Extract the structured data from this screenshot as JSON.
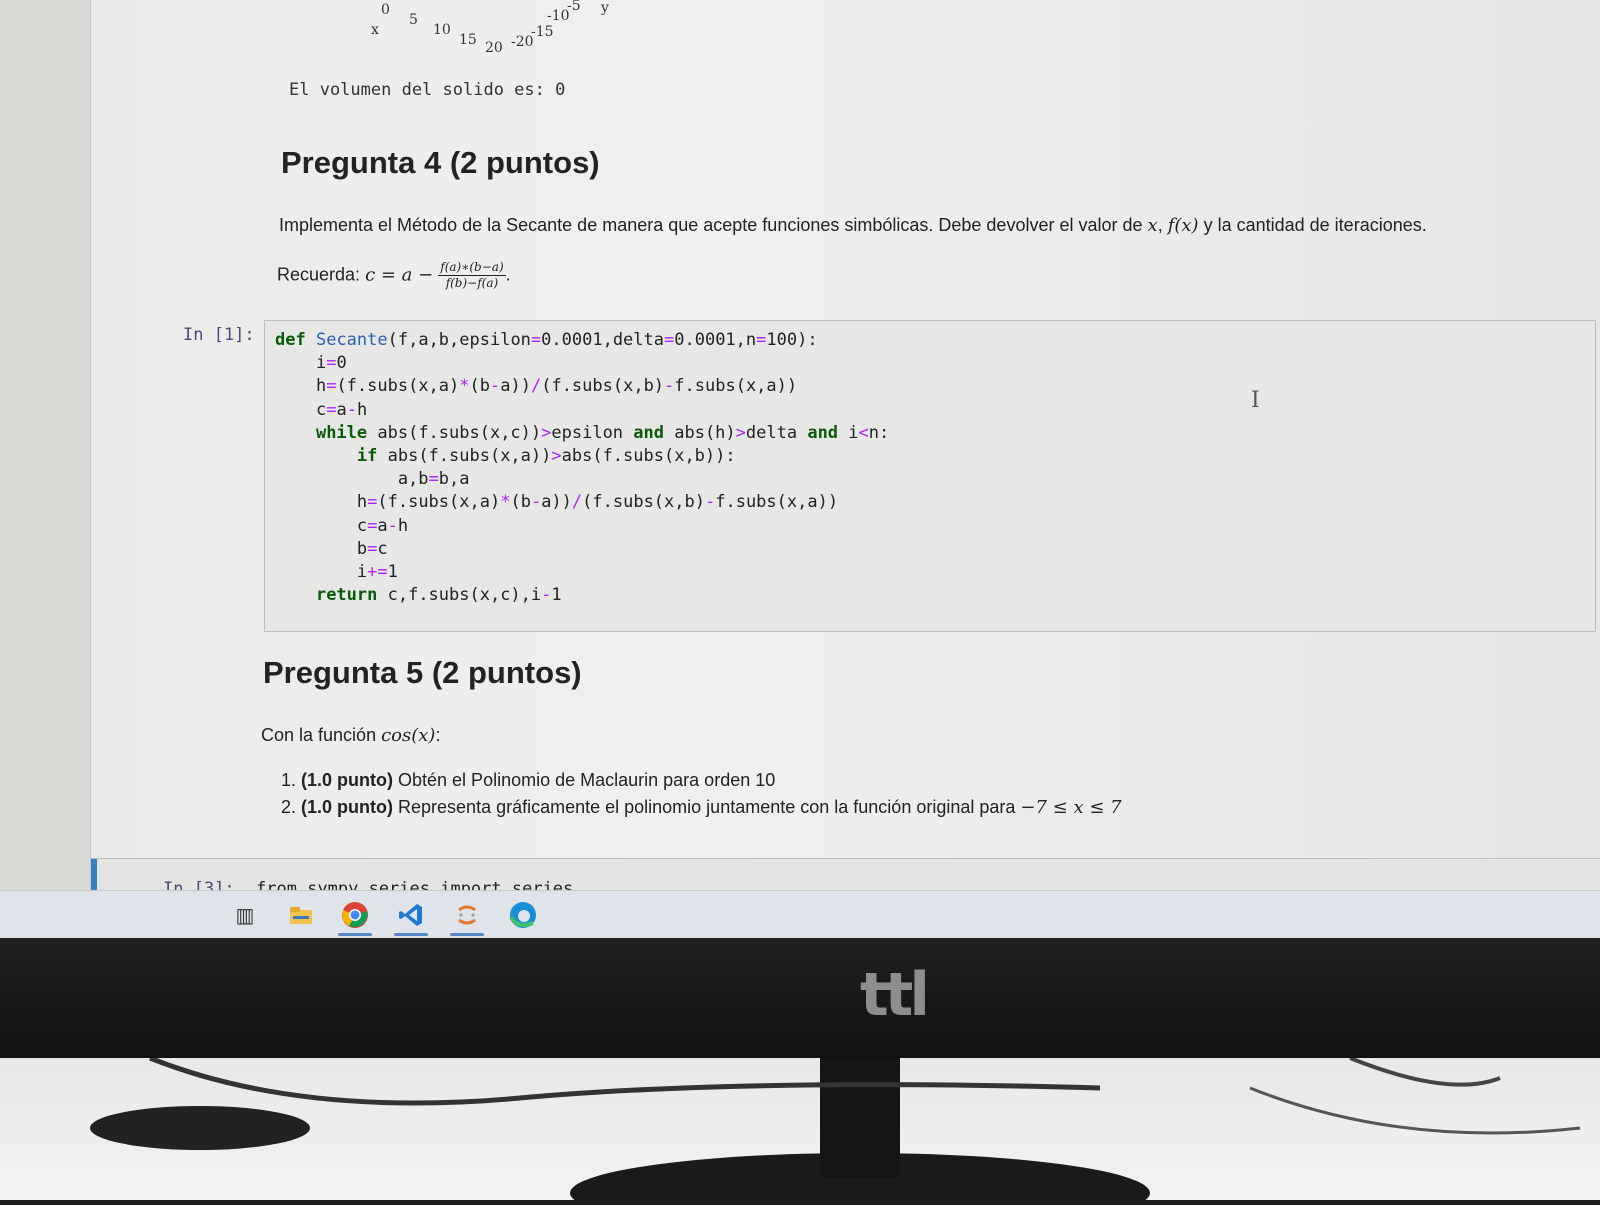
{
  "plot_ticks": {
    "x_axis": [
      "0",
      "5",
      "10",
      "15",
      "20"
    ],
    "y_axis": [
      "-20",
      "-15",
      "-10",
      "-5"
    ],
    "x_label": "x",
    "y_label": "y"
  },
  "output_text": "El volumen del solido es: 0",
  "q4": {
    "title": "Pregunta 4 (2 puntos)",
    "description": "Implementa el Método de la Secante de manera que acepte funciones simbólicas. Debe devolver el valor de",
    "desc_x": "x",
    "desc_sep": ",",
    "desc_fx": "f(x)",
    "desc_end": "y la cantidad de iteraciones.",
    "reminder_label": "Recuerda:",
    "formula_lhs": "c = a −",
    "formula_num": "f(a)∗(b−a)",
    "formula_den": "f(b)−f(a)",
    "formula_end": "."
  },
  "cell1": {
    "prompt": "In [1]:",
    "code_lines": [
      "def Secante(f,a,b,epsilon=0.0001,delta=0.0001,n=100):",
      "    i=0",
      "    h=(f.subs(x,a)*(b-a))/(f.subs(x,b)-f.subs(x,a))",
      "    c=a-h",
      "    while abs(f.subs(x,c))>epsilon and abs(h)>delta and i<n:",
      "        if abs(f.subs(x,a))>abs(f.subs(x,b)):",
      "            a,b=b,a",
      "        h=(f.subs(x,a)*(b-a))/(f.subs(x,b)-f.subs(x,a))",
      "        c=a-h",
      "        b=c",
      "        i+=1",
      "    return c,f.subs(x,c),i-1"
    ]
  },
  "q5": {
    "title": "Pregunta 5 (2 puntos)",
    "intro": "Con la función",
    "intro_math": "cos(x)",
    "intro_end": ":",
    "items": [
      {
        "bold": "(1.0 punto)",
        "text": "Obtén el Polinomio de Maclaurin para orden 10"
      },
      {
        "bold": "(1.0 punto)",
        "text": "Representa gráficamente el polinomio juntamente con la función original para",
        "math": "−7 ≤ x ≤ 7"
      }
    ]
  },
  "cell3": {
    "prompt": "In [3]:",
    "code": "from sympy.series import series"
  },
  "taskbar": {
    "icons": [
      "task-view-icon",
      "file-explorer-icon",
      "chrome-icon",
      "vscode-icon",
      "app-icon",
      "edge-icon"
    ],
    "accent": "#5a87c6"
  },
  "monitor": {
    "brand": "ttl"
  }
}
